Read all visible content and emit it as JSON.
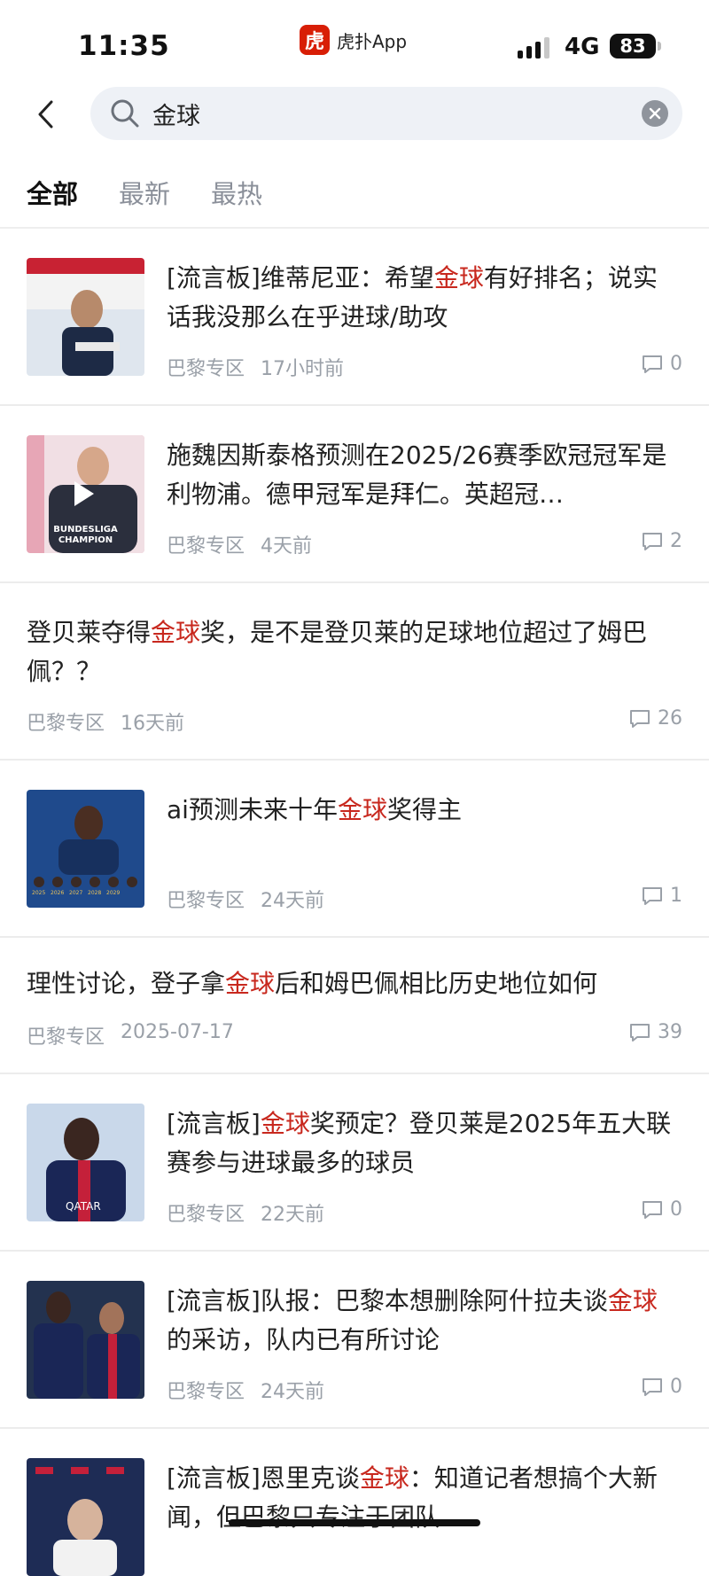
{
  "status_bar": {
    "time": "11:35",
    "app_icon_char": "虎",
    "app_name": "虎扑App",
    "network": "4G",
    "battery": "83"
  },
  "search": {
    "query": "金球",
    "back_icon": "chevron-left-icon",
    "search_icon": "magnifier-icon",
    "clear_icon": "clear-x-icon"
  },
  "tabs": [
    {
      "label": "全部",
      "active": true
    },
    {
      "label": "最新",
      "active": false
    },
    {
      "label": "最热",
      "active": false
    }
  ],
  "highlight_color": "#c8281e",
  "items": [
    {
      "title_before": "[流言板]维蒂尼亚：希望",
      "title_hl": "金球",
      "title_after": "有好排名；说实话我没那么在乎进球/助攻",
      "board": "巴黎专区",
      "time": "17小时前",
      "comments": "0",
      "thumb": true
    },
    {
      "title_before": "施魏因斯泰格预测在2025/26赛季欧冠冠军是利物浦。德甲冠军是拜仁。英超冠…",
      "title_hl": "",
      "title_after": "",
      "board": "巴黎专区",
      "time": "4天前",
      "comments": "2",
      "thumb": true,
      "thumb_label": "BUNDESLIGA CHAMPION"
    },
    {
      "title_before": "登贝莱夺得",
      "title_hl": "金球",
      "title_after": "奖，是不是登贝莱的足球地位超过了姆巴佩？？",
      "board": "巴黎专区",
      "time": "16天前",
      "comments": "26",
      "thumb": false
    },
    {
      "title_before": "ai预测未来十年",
      "title_hl": "金球",
      "title_after": "奖得主",
      "board": "巴黎专区",
      "time": "24天前",
      "comments": "1",
      "thumb": true
    },
    {
      "title_before": "理性讨论，登子拿",
      "title_hl": "金球",
      "title_after": "后和姆巴佩相比历史地位如何",
      "board": "巴黎专区",
      "time": "2025-07-17",
      "comments": "39",
      "thumb": false
    },
    {
      "title_before": "[流言板]",
      "title_hl": "金球",
      "title_after": "奖预定？登贝莱是2025年五大联赛参与进球最多的球员",
      "board": "巴黎专区",
      "time": "22天前",
      "comments": "0",
      "thumb": true
    },
    {
      "title_before": "[流言板]队报：巴黎本想删除阿什拉夫谈",
      "title_hl": "金球",
      "title_after": "的采访，队内已有所讨论",
      "board": "巴黎专区",
      "time": "24天前",
      "comments": "0",
      "thumb": true
    },
    {
      "title_before": "[流言板]恩里克谈",
      "title_hl": "金球",
      "title_after": "：知道记者想搞个大新闻，但巴黎只专注于团队",
      "board": "",
      "time": "",
      "comments": "",
      "thumb": true
    }
  ]
}
